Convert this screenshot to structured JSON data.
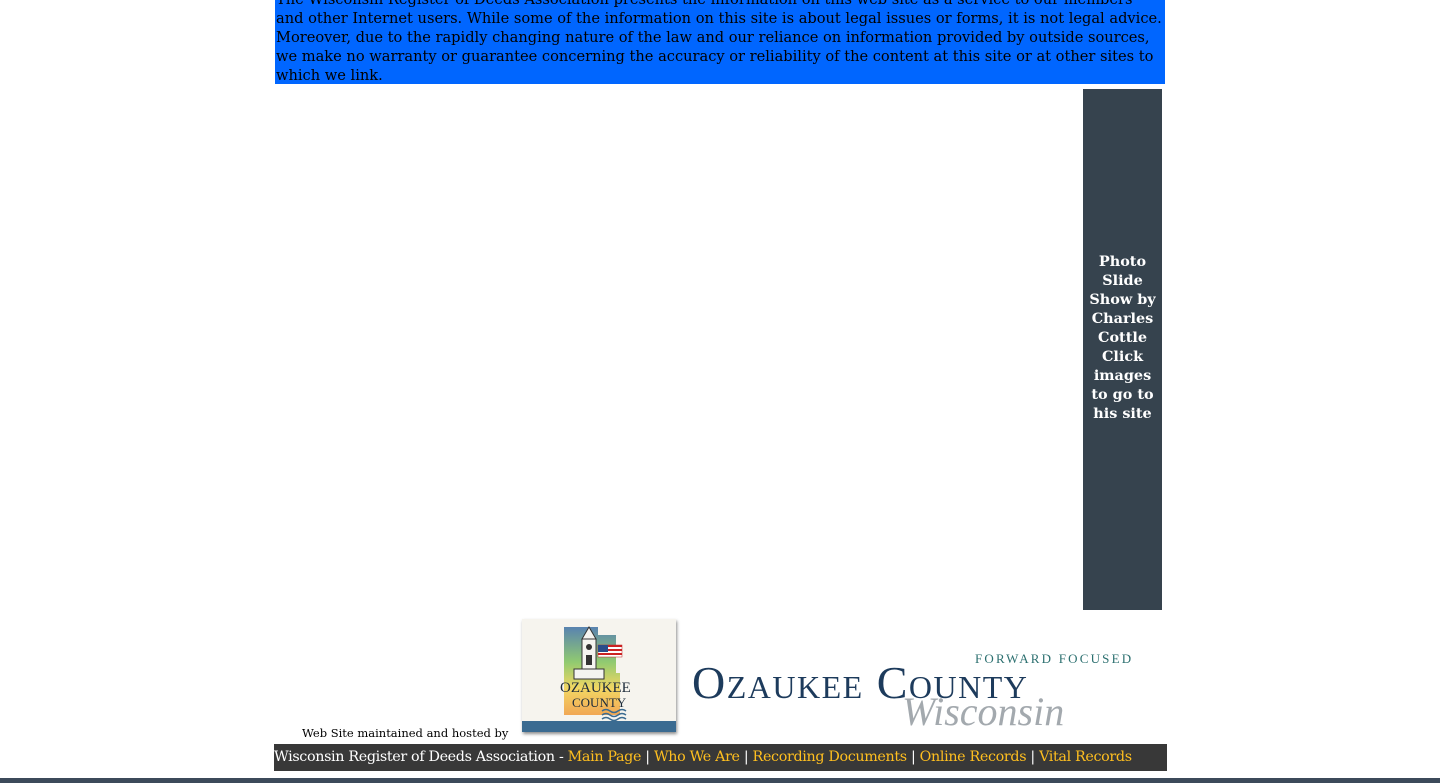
{
  "disclaimer": {
    "text": "The Wisconsin Register of Deeds Association presents the information on this web site as a service to our members and other Internet users. While some of the information on this site is about legal issues or forms, it is not legal advice. Moreover, due to the rapidly changing nature of the law and our reliance on information provided by outside sources, we make no warranty or guarantee concerning the accuracy or reliability of the content at this site or at other sites to which we link."
  },
  "sidebar": {
    "caption": "Photo Slide Show by Charles Cottle Click images to go to his site"
  },
  "hosting": {
    "label": "Web Site maintained and hosted by",
    "badge_text_top": "OZAUKEE",
    "badge_text_bottom": "COUNTY",
    "wordmark_tagline": "FORWARD FOCUSED",
    "wordmark_name": "Ozaukee County",
    "wordmark_state": "Wisconsin"
  },
  "footer": {
    "org": "Wisconsin Register of Deeds Association - ",
    "links": [
      {
        "label": "Main Page"
      },
      {
        "label": "Who We Are"
      },
      {
        "label": "Recording Documents"
      },
      {
        "label": "Online Records"
      },
      {
        "label": "Vital Records"
      }
    ],
    "separator": " | "
  },
  "colors": {
    "disclaimer_bg": "#0066ff",
    "sidebar_bg": "#36434e",
    "footer_bg": "#383838",
    "link": "#ffbf1f"
  }
}
